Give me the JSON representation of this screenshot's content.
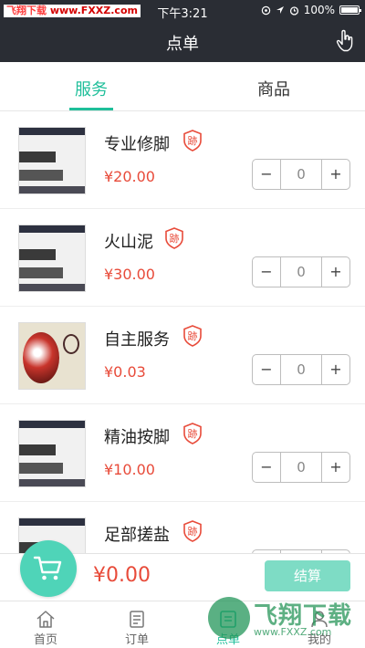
{
  "status_bar": {
    "watermark_brand": "飞翔下载",
    "watermark_url": "www.FXXZ.com",
    "time": "下午3:21",
    "battery_percent": "100%"
  },
  "nav": {
    "title": "点单"
  },
  "tabs": [
    {
      "label": "服务",
      "active": true
    },
    {
      "label": "商品",
      "active": false
    }
  ],
  "items": [
    {
      "name": "专业修脚",
      "price": "¥20.00",
      "qty": "0",
      "badge": "跡"
    },
    {
      "name": "火山泥",
      "price": "¥30.00",
      "qty": "0",
      "badge": "跡"
    },
    {
      "name": "自主服务",
      "price": "¥0.03",
      "qty": "0",
      "badge": "跡"
    },
    {
      "name": "精油按脚",
      "price": "¥10.00",
      "qty": "0",
      "badge": "跡"
    },
    {
      "name": "足部搓盐",
      "price": "",
      "qty": "0",
      "badge": "跡"
    }
  ],
  "stepper": {
    "minus": "−",
    "plus": "+"
  },
  "checkout": {
    "total": "¥0.00",
    "settle_label": "结算"
  },
  "tabbar": [
    {
      "label": "首页",
      "icon": "home-icon"
    },
    {
      "label": "订单",
      "icon": "order-icon"
    },
    {
      "label": "点单",
      "icon": "pad-icon",
      "active": true
    },
    {
      "label": "我的",
      "icon": "user-icon"
    }
  ],
  "watermark": {
    "text": "飞翔下载",
    "url": "www.FXXZ.com"
  },
  "colors": {
    "accent": "#1fbf9a",
    "price": "#e84b3a",
    "header": "#2a2d34",
    "settle": "#7edcc5"
  }
}
